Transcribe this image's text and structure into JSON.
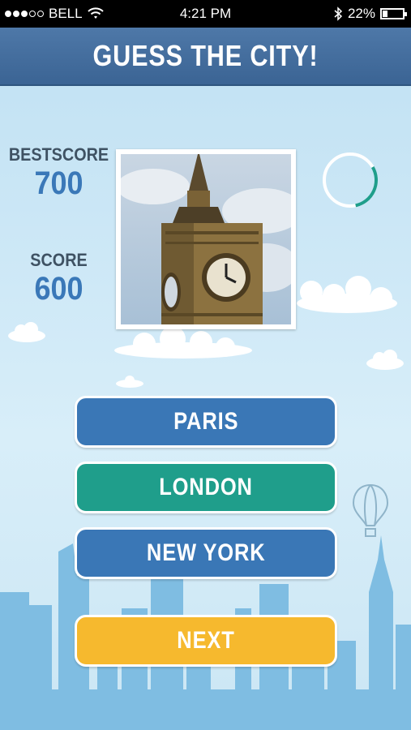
{
  "status_bar": {
    "carrier": "BELL",
    "time": "4:21 PM",
    "battery": "22%",
    "signal_bars_filled": 3,
    "signal_bars_total": 5,
    "battery_level": 0.22
  },
  "header": {
    "title": "GUESS THE CITY!"
  },
  "scores": {
    "best_label": "BESTSCORE",
    "best_value": "700",
    "score_label": "SCORE",
    "score_value": "600"
  },
  "timer": {
    "progress": 0.3,
    "color": "#1f9e8b"
  },
  "answers": [
    {
      "label": "PARIS",
      "color": "#3a77b6"
    },
    {
      "label": "LONDON",
      "color": "#1f9e8b"
    },
    {
      "label": "NEW YORK",
      "color": "#3a77b6"
    }
  ],
  "next_button": {
    "label": "NEXT",
    "color": "#f6b92e"
  },
  "icons": {
    "wifi": "wifi-icon",
    "bluetooth": "bluetooth-icon",
    "battery": "battery-icon",
    "balloon": "hot-air-balloon-icon",
    "timer": "timer-ring-icon"
  }
}
